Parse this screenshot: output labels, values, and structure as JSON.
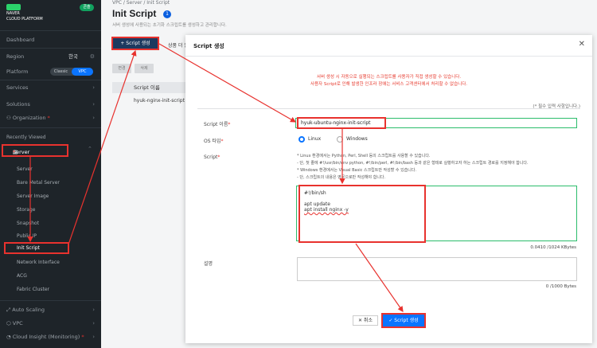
{
  "sidebar": {
    "logo_line1": "NAVER",
    "logo_line2": "CLOUD PLATFORM",
    "badge": "콘솔",
    "dashboard": "Dashboard",
    "region_label": "Region",
    "region_value": "한국",
    "platform_label": "Platform",
    "platform_options": [
      "Classic",
      "VPC"
    ],
    "services": "Services",
    "solutions": "Solutions",
    "organization": "Organization",
    "recently_viewed": "Recently Viewed",
    "server": "Server",
    "sub_items": [
      "Server",
      "Bare Metal Server",
      "Server Image",
      "Storage",
      "Snapshot",
      "Public IP",
      "Init Script",
      "Network Interface",
      "ACG",
      "Fabric Cluster"
    ],
    "bottom_items": [
      "Auto Scaling",
      "VPC",
      "Cloud Insight (Monitoring)"
    ]
  },
  "main": {
    "breadcrumb": "VPC  /  Server  /  Init Script",
    "title": "Init Script",
    "count": "1",
    "description": "서버 생성에 사용되는 초기화 스크립트를 생성하고 관리합니다.",
    "create_button": "+  Script 생성",
    "other_tab": "상품 더 알",
    "grey_buttons": [
      "변경",
      "삭제"
    ],
    "list_header": "Script 이름",
    "list_row": "hyuk-nginx-init-script"
  },
  "modal": {
    "title": "Script 생성",
    "close": "✕",
    "notice_line1": "서버 생성 시 자동으로 실행되는 스크립트를 사용자가 직접 생성할 수 있습니다.",
    "notice_line2": "사용자 Script로 인해 발생한 인프라 장애는 서비스 고객센터에서 처리할 수 없습니다.",
    "required_note": "(* 필수 입력 사항입니다.)",
    "script_name_label": "Script 이름",
    "script_name_value": "hyuk-ubuntu-nginx-init-script",
    "os_label": "OS 타입",
    "os_options": [
      "Linux",
      "Windows"
    ],
    "script_label": "Script",
    "info_lines": [
      "* Linux 환경에서는 Python, Perl, Shell 등의 스크립트를 사용할 수 있습니다.",
      "  - 단, 첫 줄에 #!/usr/bin/env python, #!/bin/perl, #!/bin/bash 등과 같은 형태로 실행하고자 하는 스크립트 경로를 지정해야 합니다.",
      "* Windows 환경에서는 Visual Basic 스크립트만 작성할 수 있습니다.",
      "  - 단, 스크립트의 내용은 영문으로만 작성해야 합니다."
    ],
    "script_lines": [
      "#!/bin/sh",
      "",
      "apt update",
      "apt install nginx -y"
    ],
    "script_bytes": "0.0410 /1024 KBytes",
    "desc_label": "설명",
    "desc_bytes": "0 /1000 Bytes",
    "cancel": "✕  취소",
    "confirm": "✓  Script 생성"
  }
}
